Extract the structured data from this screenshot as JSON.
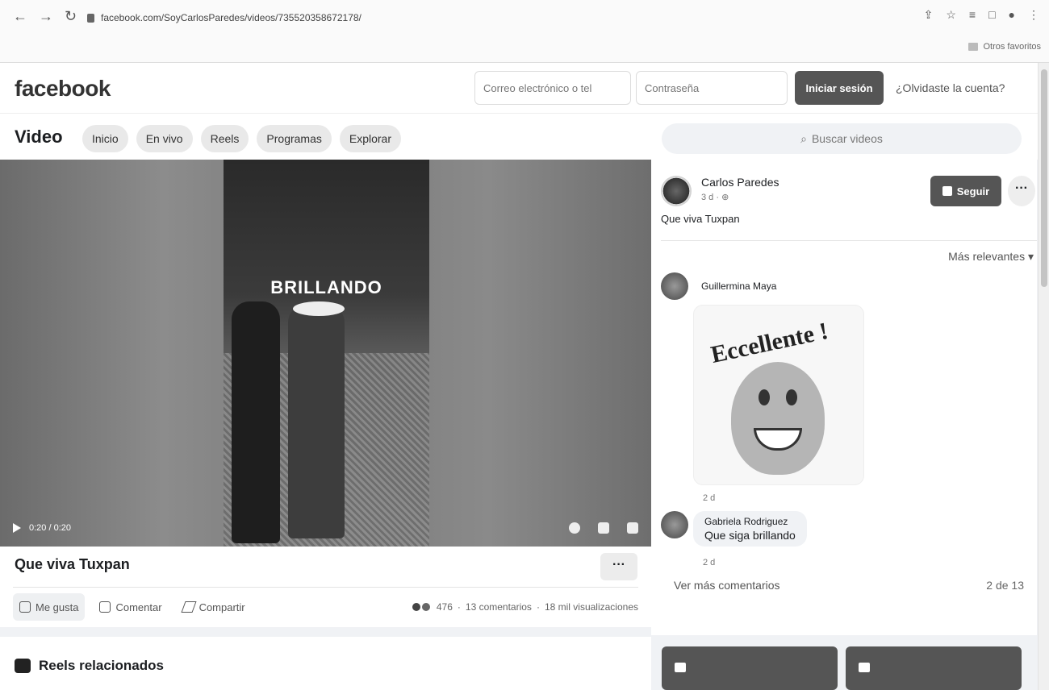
{
  "browser": {
    "url": "facebook.com/SoyCarlosParedes/videos/735520358672178/",
    "bookmarks_label": "Otros favoritos"
  },
  "header": {
    "logo": "facebook",
    "email_placeholder": "Correo electrónico o tel",
    "password_placeholder": "Contraseña",
    "login_button": "Iniciar sesión",
    "forgot_link": "¿Olvidaste la cuenta?"
  },
  "video_nav": {
    "title": "Video",
    "tabs": [
      "Inicio",
      "En vivo",
      "Reels",
      "Programas",
      "Explorar"
    ],
    "search_placeholder": "Buscar videos"
  },
  "player": {
    "overlay_text": "BRILLANDO",
    "time": "0:20 / 0:20"
  },
  "post": {
    "title": "Que viva Tuxpan",
    "actions": {
      "like": "Me gusta",
      "comment": "Comentar",
      "share": "Compartir"
    },
    "reactions_count": "476",
    "comments_count": "13 comentarios",
    "views": "18 mil visualizaciones"
  },
  "reels": {
    "label": "Reels relacionados"
  },
  "author": {
    "name": "Carlos Paredes",
    "meta": "3 d · ",
    "caption": "Que viva Tuxpan",
    "follow_label": "Seguir"
  },
  "comments": {
    "sort_label": "Más relevantes",
    "items": [
      {
        "name": "Guillermina Maya",
        "sticker_text": "Eccellente !",
        "time": "2 d"
      },
      {
        "name": "Gabriela Rodriguez",
        "text": "Que siga brillando",
        "time": "2 d"
      }
    ],
    "more_label": "Ver más comentarios",
    "count_label": "2 de 13"
  },
  "colors": {
    "accent_gray": "#555555",
    "background": "#f0f2f5"
  }
}
